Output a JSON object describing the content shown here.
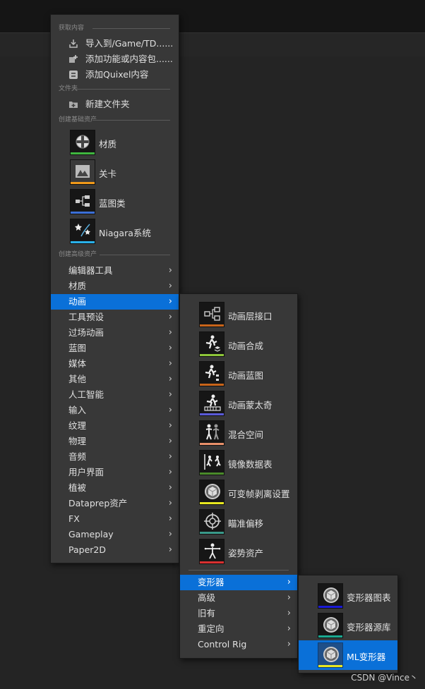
{
  "main_menu": {
    "sections": {
      "get_content": "获取内容",
      "folder": "文件夹",
      "basic_assets": "创建基础资产",
      "advanced_assets": "创建高级资产"
    },
    "get_content_items": [
      {
        "label": "导入到/Game/TD......",
        "icon": "import-icon"
      },
      {
        "label": "添加功能或内容包......",
        "icon": "feature-pack-icon"
      },
      {
        "label": "添加Quixel内容",
        "icon": "quixel-icon"
      }
    ],
    "folder_items": [
      {
        "label": "新建文件夹",
        "icon": "new-folder-icon"
      }
    ],
    "basic_assets": [
      {
        "label": "材质",
        "icon": "material-icon",
        "color": "#3fb63f"
      },
      {
        "label": "关卡",
        "icon": "level-icon",
        "color": "#f09a1a"
      },
      {
        "label": "蓝图类",
        "icon": "blueprint-class-icon",
        "color": "#3b6fd6"
      },
      {
        "label": "Niagara系统",
        "icon": "niagara-icon",
        "color": "#2ab0e8"
      }
    ],
    "advanced_items": [
      "编辑器工具",
      "材质",
      "动画",
      "工具预设",
      "过场动画",
      "蓝图",
      "媒体",
      "其他",
      "人工智能",
      "输入",
      "纹理",
      "物理",
      "音频",
      "用户界面",
      "植被",
      "Dataprep资产",
      "FX",
      "Gameplay",
      "Paper2D"
    ],
    "selected": "动画"
  },
  "animation_menu": {
    "assets": [
      {
        "label": "动画层接口",
        "icon": "anim-layer-interface-icon",
        "color": "#c8641a"
      },
      {
        "label": "动画合成",
        "icon": "anim-composite-icon",
        "color": "#8ec63a"
      },
      {
        "label": "动画蓝图",
        "icon": "anim-blueprint-icon",
        "color": "#c8641a"
      },
      {
        "label": "动画蒙太奇",
        "icon": "anim-montage-icon",
        "color": "#5a5ad8"
      },
      {
        "label": "混合空间",
        "icon": "blend-space-icon",
        "color": "#e8906a"
      },
      {
        "label": "镜像数据表",
        "icon": "mirror-table-icon",
        "color": "#4a8a2a"
      },
      {
        "label": "可变帧剥离设置",
        "icon": "frame-strip-icon",
        "color": "#e8e820"
      },
      {
        "label": "瞄准偏移",
        "icon": "aim-offset-icon",
        "color": "#3a9a8a"
      },
      {
        "label": "姿势资产",
        "icon": "pose-asset-icon",
        "color": "#d83030"
      }
    ],
    "submenus": [
      "变形器",
      "高级",
      "旧有",
      "重定向",
      "Control Rig"
    ],
    "selected": "变形器"
  },
  "deformer_menu": {
    "assets": [
      {
        "label": "变形器图表",
        "icon": "deformer-graph-icon",
        "color": "#1a1ad8"
      },
      {
        "label": "变形器源库",
        "icon": "deformer-library-icon",
        "color": "#1aa890"
      },
      {
        "label": "ML变形器",
        "icon": "ml-deformer-icon",
        "color": "#e8e820"
      }
    ],
    "selected": "ML变形器"
  },
  "watermark": "CSDN @Vince丶"
}
